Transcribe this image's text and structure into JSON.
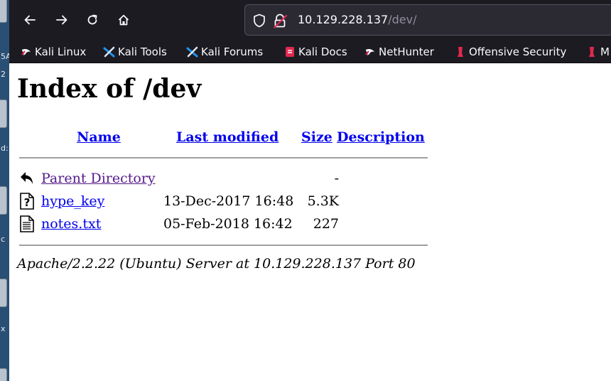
{
  "browser": {
    "url_host": "10.129.228.137",
    "url_path": "/dev/"
  },
  "bookmarks": [
    {
      "label": "Kali Linux",
      "icon": "kali-dragon-icon"
    },
    {
      "label": "Kali Tools",
      "icon": "kali-tools-icon"
    },
    {
      "label": "Kali Forums",
      "icon": "kali-forums-icon"
    },
    {
      "label": "Kali Docs",
      "icon": "kali-docs-icon"
    },
    {
      "label": "NetHunter",
      "icon": "nethunter-icon"
    },
    {
      "label": "Offensive Security",
      "icon": "offsec-icon"
    },
    {
      "label": "M",
      "icon": "offsec-icon"
    }
  ],
  "desktop_strip": [
    "5A",
    "2",
    "d:",
    "c",
    "x"
  ],
  "page": {
    "title": "Index of /dev",
    "columns": {
      "name": "Name",
      "last_modified": "Last modified",
      "size": "Size",
      "description": "Description"
    },
    "entries": [
      {
        "name": "Parent Directory",
        "modified": "",
        "size": "-",
        "icon": "parent-directory-icon"
      },
      {
        "name": "hype_key",
        "modified": "13-Dec-2017 16:48",
        "size": "5.3K",
        "icon": "unknown-file-icon"
      },
      {
        "name": "notes.txt",
        "modified": "05-Feb-2018 16:42",
        "size": "227",
        "icon": "text-file-icon"
      }
    ],
    "address": "Apache/2.2.22 (Ubuntu) Server at 10.129.228.137 Port 80"
  }
}
